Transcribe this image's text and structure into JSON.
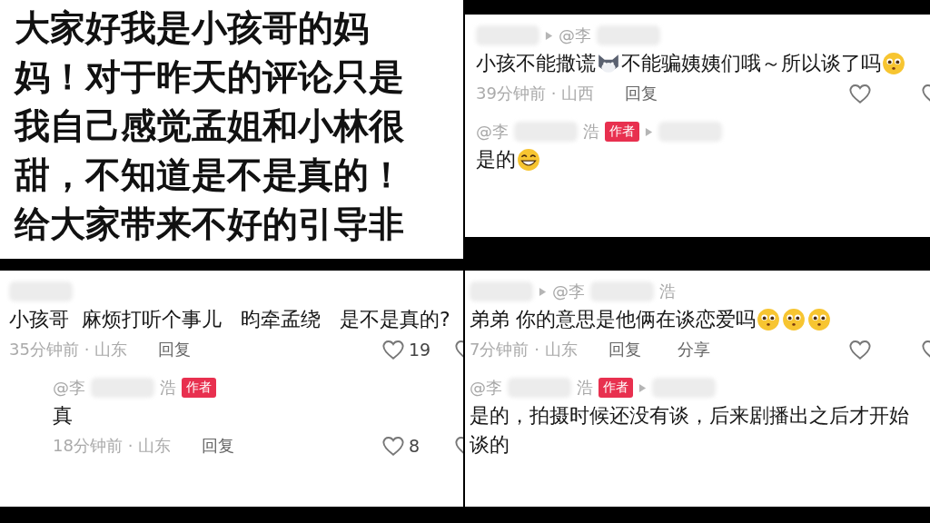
{
  "post": {
    "lines": [
      "大家好我是小孩哥的妈",
      "妈！对于昨天的评论只是",
      "我自己感觉孟姐和小林很",
      "甜，不知道是不是真的！",
      "给大家带来不好的引导非"
    ]
  },
  "panels": [
    {
      "comments": [
        {
          "header": [
            {
              "kind": "blur"
            },
            {
              "kind": "arrow"
            },
            {
              "kind": "name",
              "text": "@李"
            },
            {
              "kind": "blur"
            }
          ],
          "body": [
            {
              "kind": "text",
              "text": "小孩不能撒谎"
            },
            {
              "kind": "cat"
            },
            {
              "kind": "text",
              "text": "不能骗姨姨们哦～所以谈了吗"
            },
            {
              "kind": "pleading"
            }
          ],
          "meta": "39分钟前 · 山西",
          "actions": [
            "回复"
          ]
        },
        {
          "header": [
            {
              "kind": "name",
              "text": "@李"
            },
            {
              "kind": "blur"
            },
            {
              "kind": "name",
              "text": "浩"
            },
            {
              "kind": "badge",
              "text": "作者"
            },
            {
              "kind": "arrow"
            },
            {
              "kind": "blur"
            }
          ],
          "body": [
            {
              "kind": "text",
              "text": "是的"
            },
            {
              "kind": "grin"
            }
          ]
        }
      ]
    },
    {
      "comments": [
        {
          "header": [
            {
              "kind": "blur"
            }
          ],
          "body": [
            {
              "kind": "text",
              "text": "小孩哥  麻烦打听个事儿   昀牵孟绕   是不是真的?"
            }
          ],
          "meta": "35分钟前 · 山东",
          "actions": [
            "回复"
          ],
          "likes": "19"
        },
        {
          "indent": true,
          "header": [
            {
              "kind": "name",
              "text": "@李"
            },
            {
              "kind": "blur"
            },
            {
              "kind": "name",
              "text": "浩"
            },
            {
              "kind": "badge",
              "text": "作者"
            }
          ],
          "body": [
            {
              "kind": "text",
              "text": "真"
            }
          ],
          "meta": "18分钟前 · 山东",
          "actions": [
            "回复"
          ],
          "likes": "8"
        }
      ]
    },
    {
      "comments": [
        {
          "header": [
            {
              "kind": "blur"
            },
            {
              "kind": "arrow"
            },
            {
              "kind": "name",
              "text": "@李"
            },
            {
              "kind": "blur"
            },
            {
              "kind": "name",
              "text": "浩"
            }
          ],
          "body": [
            {
              "kind": "text",
              "text": "弟弟 你的意思是他俩在谈恋爱吗"
            },
            {
              "kind": "pleading"
            },
            {
              "kind": "pleading"
            },
            {
              "kind": "pleading"
            }
          ],
          "meta": "7分钟前 · 山东",
          "actions": [
            "回复",
            "分享"
          ]
        },
        {
          "header": [
            {
              "kind": "name",
              "text": "@李"
            },
            {
              "kind": "blur"
            },
            {
              "kind": "name",
              "text": "浩"
            },
            {
              "kind": "badge",
              "text": "作者"
            },
            {
              "kind": "arrow"
            },
            {
              "kind": "blur"
            }
          ],
          "body": [
            {
              "kind": "text",
              "text": "是的，拍摄时候还没有谈，后来剧播出之后才开始谈的"
            }
          ]
        }
      ]
    }
  ]
}
